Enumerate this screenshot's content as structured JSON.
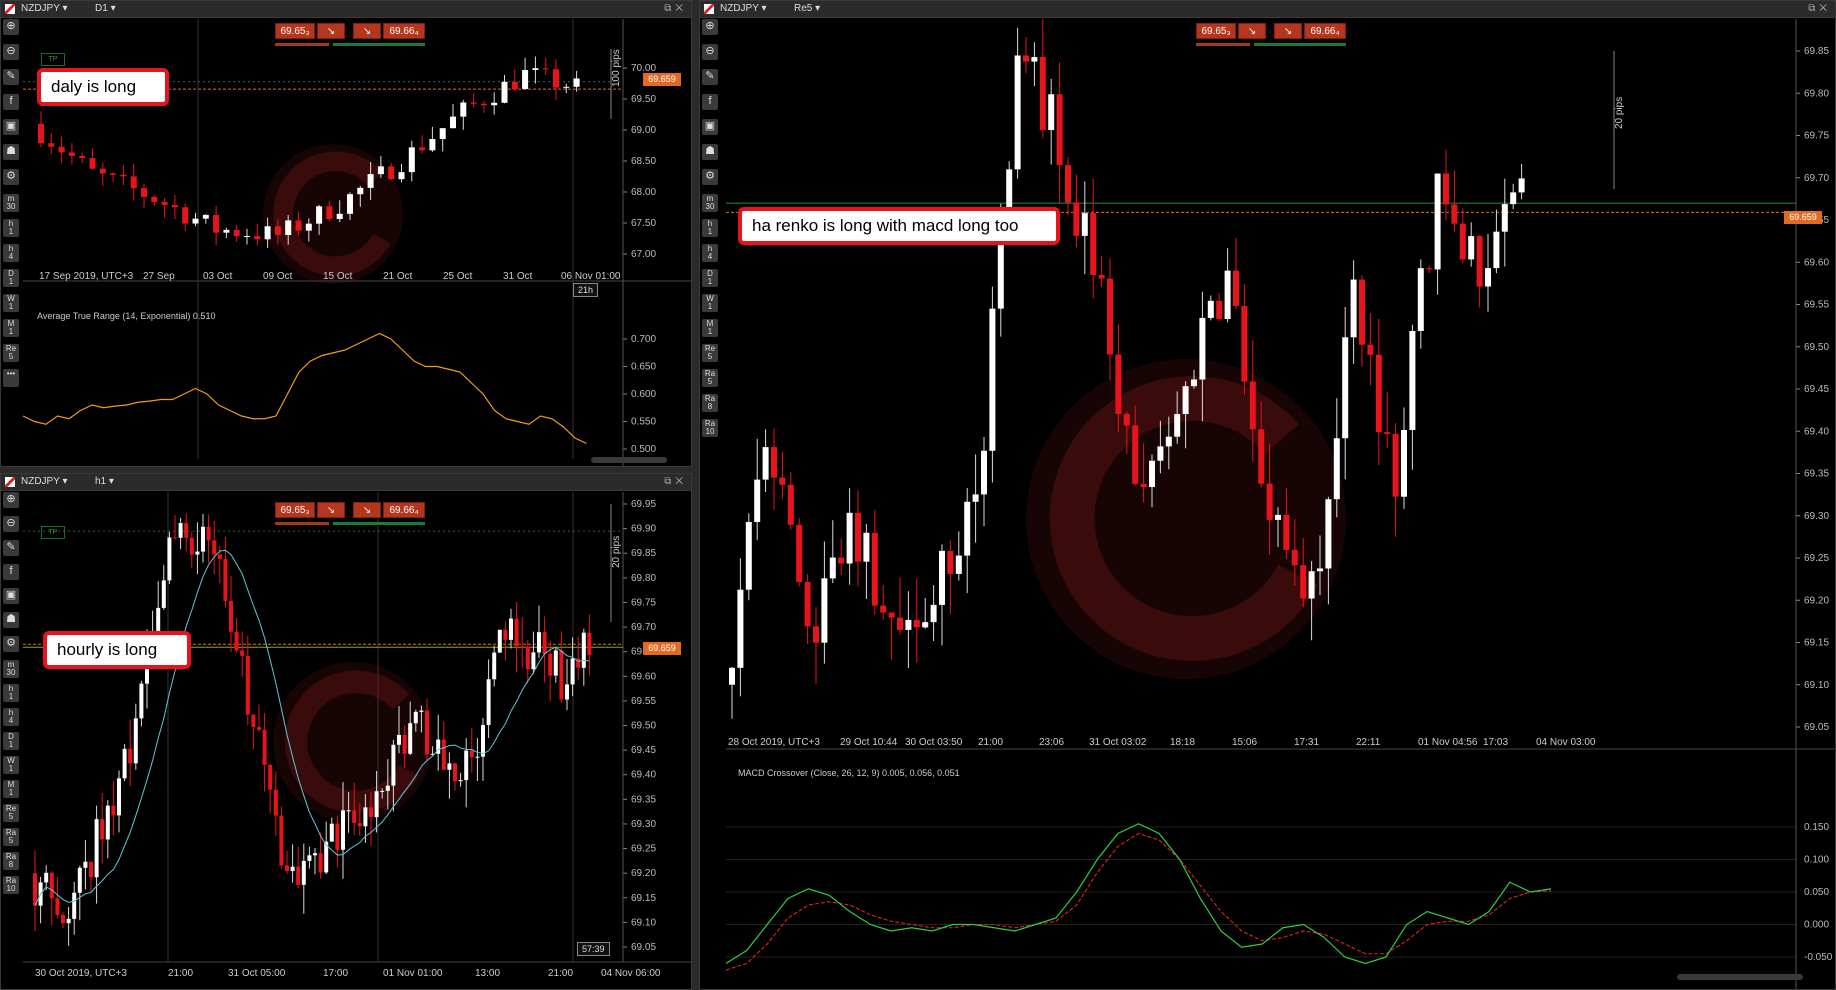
{
  "windows": {
    "daily": {
      "symbol": "NZDJPY",
      "timeframe": "D1",
      "bid": "69.65₃",
      "ask": "69.66₄",
      "price_tag": "69.659",
      "pips_label": "100 pips",
      "timer": "21h",
      "tp": "TP",
      "price_ticks": [
        "70.00",
        "69.50",
        "69.00",
        "68.50",
        "68.00",
        "67.50",
        "67.00"
      ],
      "time_ticks": [
        "17 Sep 2019, UTC+3",
        "27 Sep",
        "03 Oct",
        "09 Oct",
        "15 Oct",
        "21 Oct",
        "25 Oct",
        "31 Oct",
        "06 Nov 01:00"
      ],
      "indicator": {
        "label": "Average True Range (14, Exponential) 0.510",
        "ticks": [
          "0.700",
          "0.650",
          "0.600",
          "0.550",
          "0.500"
        ],
        "color": "#f39c12"
      },
      "note": "daly is long"
    },
    "hourly": {
      "symbol": "NZDJPY",
      "timeframe": "h1",
      "bid": "69.65₃",
      "ask": "69.66₄",
      "price_tag": "69.659",
      "pips_label": "20 pips",
      "timer": "57:39",
      "tp": "TP",
      "price_ticks": [
        "69.95",
        "69.90",
        "69.85",
        "69.80",
        "69.75",
        "69.70",
        "69.65",
        "69.60",
        "69.55",
        "69.50",
        "69.45",
        "69.40",
        "69.35",
        "69.30",
        "69.25",
        "69.20",
        "69.15",
        "69.10",
        "69.05"
      ],
      "time_ticks": [
        "30 Oct 2019, UTC+3",
        "21:00",
        "31 Oct 05:00",
        "17:00",
        "01 Nov 01:00",
        "13:00",
        "21:00",
        "04 Nov 06:00"
      ],
      "note": "hourly is long",
      "ma_color": "#5fc8d8"
    },
    "renko": {
      "symbol": "NZDJPY",
      "timeframe": "Re5",
      "bid": "69.65₃",
      "ask": "69.66₄",
      "price_tag": "69.659",
      "pips_label": "20 pips",
      "price_ticks": [
        "69.85",
        "69.80",
        "69.75",
        "69.70",
        "69.65",
        "69.60",
        "69.55",
        "69.50",
        "69.45",
        "69.40",
        "69.35",
        "69.30",
        "69.25",
        "69.20",
        "69.15",
        "69.10",
        "69.05"
      ],
      "time_ticks": [
        "28 Oct 2019, UTC+3",
        "29 Oct 10:44",
        "30 Oct 03:50",
        "21:00",
        "23:06",
        "31 Oct 03:02",
        "18:18",
        "15:06",
        "17:31",
        "22:11",
        "01 Nov 04:56",
        "17:03",
        "04 Nov 03:00"
      ],
      "indicator": {
        "label": "MACD Crossover (Close, 26, 12, 9) 0.005, 0.056, 0.051",
        "ticks": [
          "0.150",
          "0.100",
          "0.050",
          "0.000",
          "-0.050"
        ],
        "macd_color": "#2ecc40",
        "signal_color": "#e0241b"
      },
      "note": "ha renko is long with macd long too"
    }
  },
  "toolbar": {
    "icons": [
      "zoom-in-icon",
      "zoom-out-icon",
      "draw-icon",
      "facebook-icon",
      "robot-icon",
      "user-icon",
      "settings-icon"
    ],
    "timeframes_small": [
      [
        "m",
        "30"
      ],
      [
        "h",
        "1"
      ],
      [
        "h",
        "4"
      ],
      [
        "D",
        "1"
      ],
      [
        "W",
        "1"
      ],
      [
        "M",
        "1"
      ],
      [
        "Re",
        "5"
      ],
      [
        "•••",
        ""
      ]
    ],
    "timeframes_large": [
      [
        "m",
        "30"
      ],
      [
        "h",
        "1"
      ],
      [
        "h",
        "4"
      ],
      [
        "D",
        "1"
      ],
      [
        "W",
        "1"
      ],
      [
        "M",
        "1"
      ],
      [
        "Re",
        "5"
      ],
      [
        "Ra",
        "5"
      ],
      [
        "Ra",
        "8"
      ],
      [
        "Ra",
        "10"
      ]
    ]
  },
  "colors": {
    "bull": "#ffffff",
    "bear": "#e8141c",
    "accent": "#e46a24"
  }
}
